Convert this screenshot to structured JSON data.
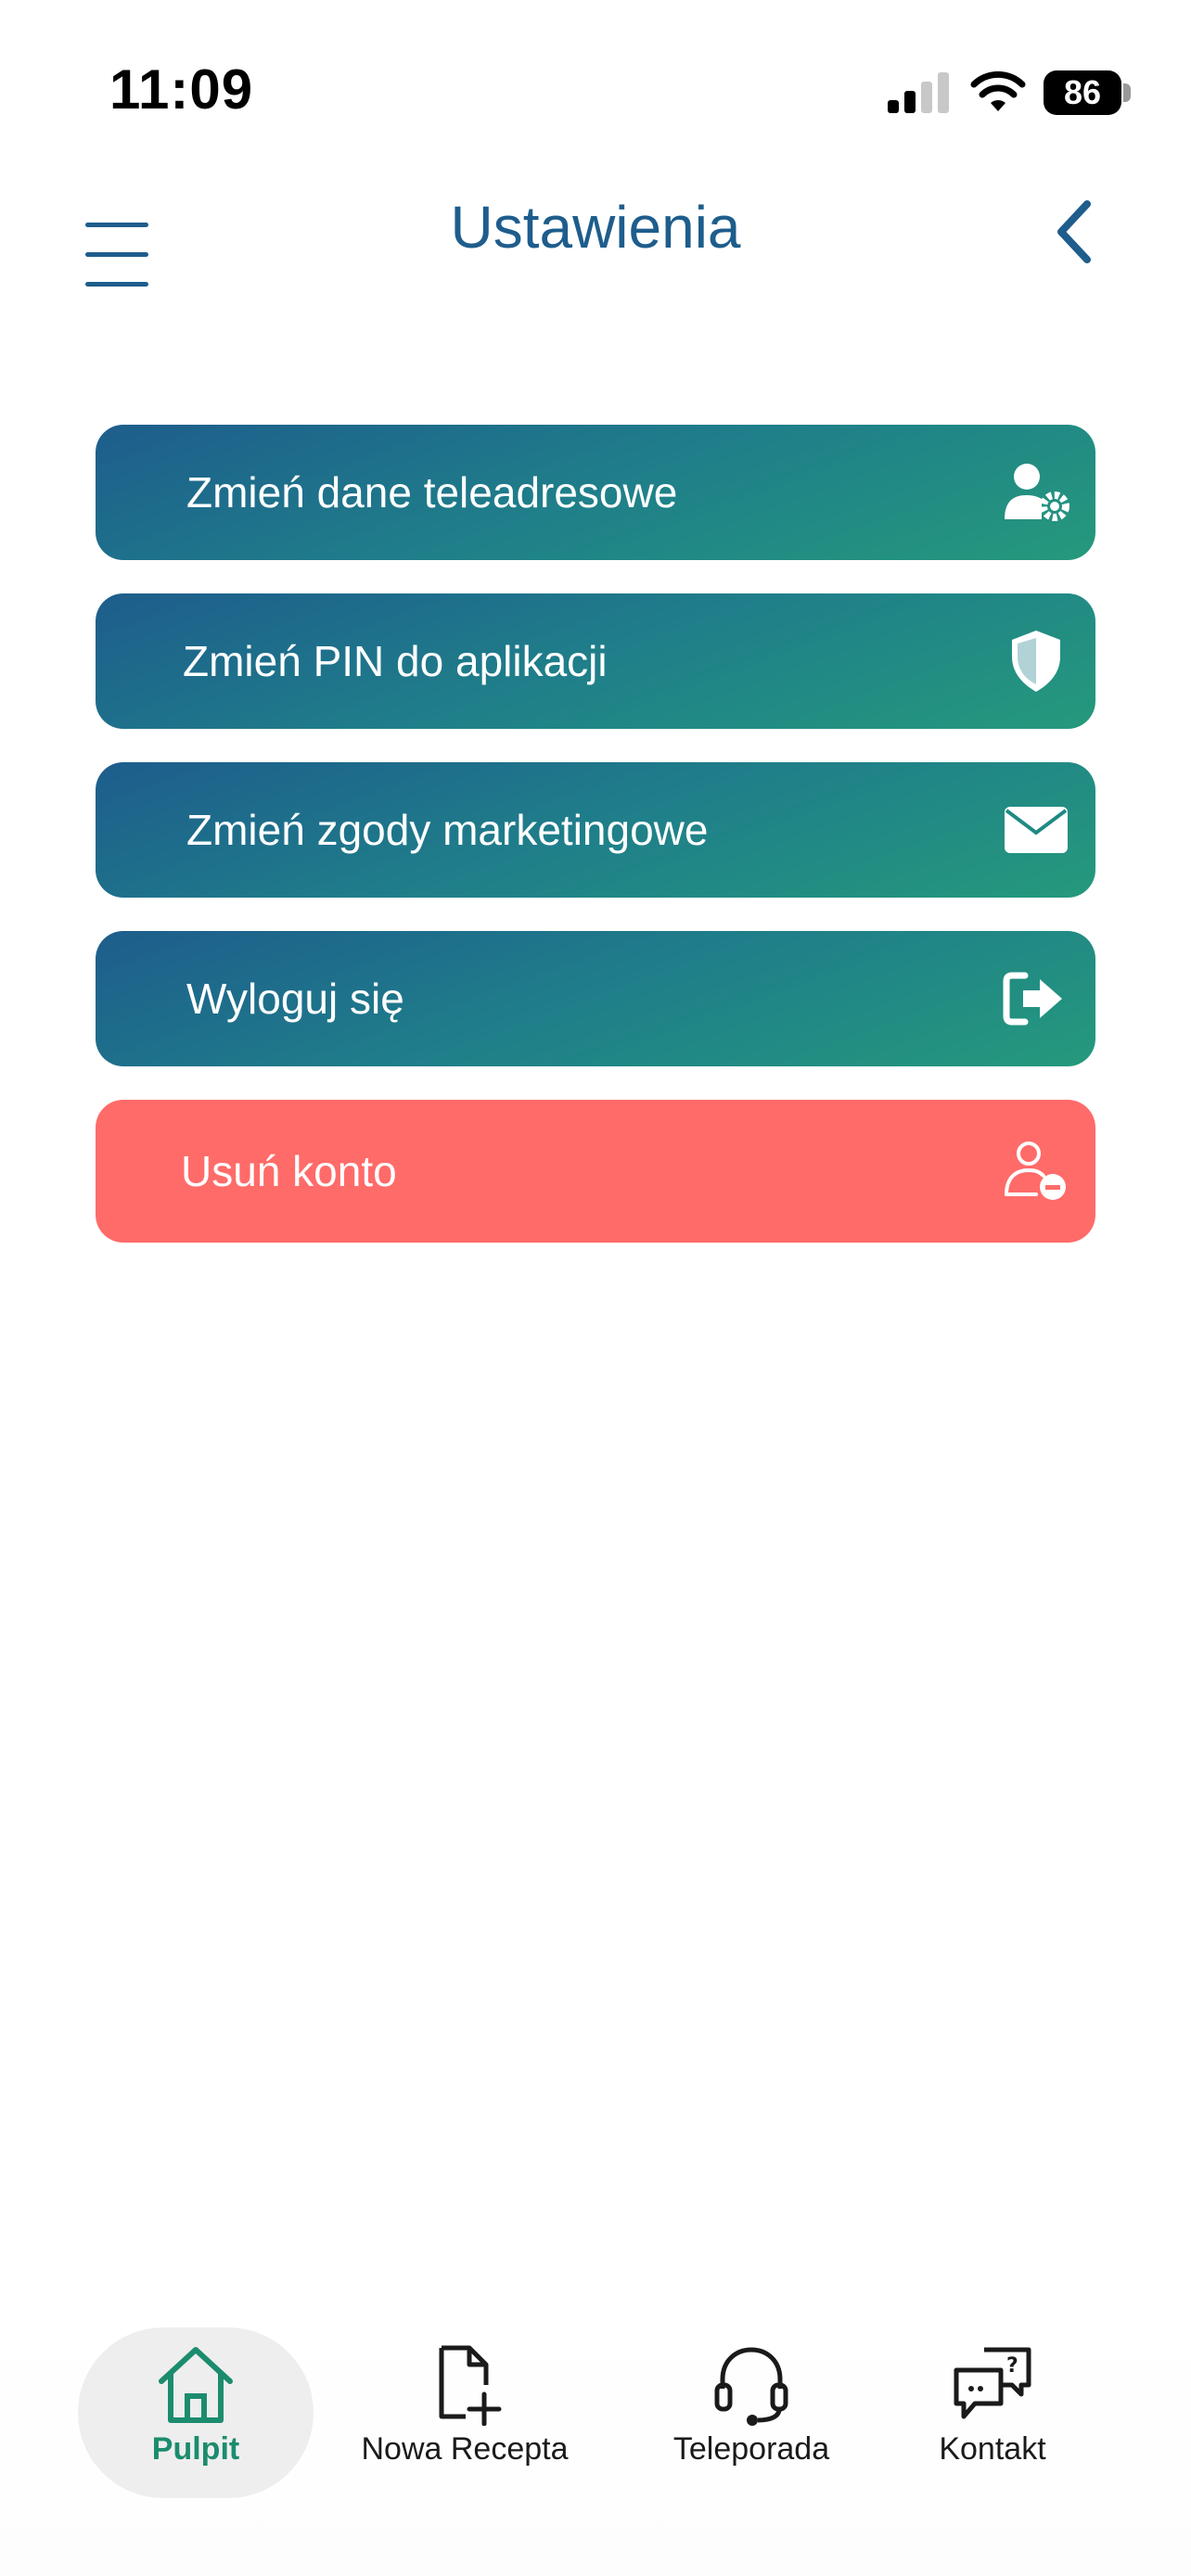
{
  "status_bar": {
    "time": "11:09",
    "battery_level": "86"
  },
  "header": {
    "title": "Ustawienia"
  },
  "menu": {
    "items": [
      {
        "label": "Zmień dane teleadresowe",
        "icon": "user-gear-icon"
      },
      {
        "label": "Zmień PIN do aplikacji",
        "icon": "shield-icon"
      },
      {
        "label": "Zmień zgody marketingowe",
        "icon": "envelope-icon"
      },
      {
        "label": "Wyloguj się",
        "icon": "logout-icon"
      },
      {
        "label": "Usuń konto",
        "icon": "user-remove-icon"
      }
    ]
  },
  "bottom_nav": {
    "items": [
      {
        "label": "Pulpit",
        "icon": "home-icon",
        "active": true
      },
      {
        "label": "Nowa Recepta",
        "icon": "file-add-icon",
        "active": false
      },
      {
        "label": "Teleporada",
        "icon": "headset-icon",
        "active": false
      },
      {
        "label": "Kontakt",
        "icon": "chat-question-icon",
        "active": false
      }
    ]
  },
  "colors": {
    "primary": "#1e5d8c",
    "gradient_end": "#25997c",
    "danger": "#ff6b69",
    "active_nav": "#1b8c6e"
  }
}
